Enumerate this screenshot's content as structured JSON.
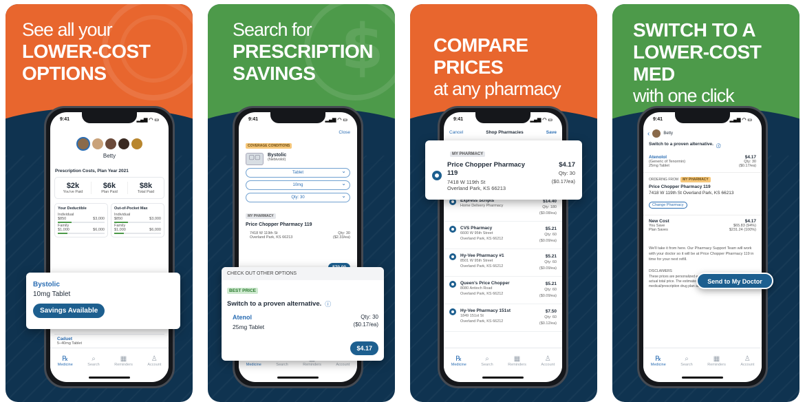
{
  "cards": [
    {
      "headline": {
        "light": "See all your",
        "bold": "LOWER-COST OPTIONS"
      },
      "band_color": "#e8662e",
      "phone": {
        "time": "9:41",
        "user_name": "Betty",
        "section_title": "Prescription Costs, Plan Year 2021",
        "stats": [
          {
            "value": "$2k",
            "label": "You've Paid"
          },
          {
            "value": "$6k",
            "label": "Plan Paid"
          },
          {
            "value": "$8k",
            "label": "Total Paid"
          }
        ],
        "deductible": {
          "title": "Your Deductible",
          "individual": "Individual",
          "family": "Family",
          "v1": "$850",
          "v2": "$3,000",
          "v3": "$1,000",
          "v4": "$6,000"
        },
        "oop": {
          "title": "Out-of-Pocket Max",
          "individual": "Individual",
          "family": "Family",
          "v1": "$850",
          "v2": "$3,000",
          "v3": "$1,000",
          "v4": "$6,000"
        },
        "list_item": {
          "name": "Caduet",
          "detail": "5–40mg Tablet"
        },
        "tabs": [
          "Medicine",
          "Search",
          "Reminders",
          "Account"
        ]
      },
      "popup": {
        "drug": "Bystolic",
        "dose": "10mg Tablet",
        "button": "Savings Available"
      }
    },
    {
      "headline": {
        "light": "Search for",
        "bold": "PRESCRIPTION SAVINGS"
      },
      "band_color": "#4d9a4a",
      "phone": {
        "time": "9:41",
        "close": "Close",
        "badge": "COVERAGE CONDITIONS",
        "drug": "Bystolic",
        "generic": "(Nebivolol)",
        "selects": [
          "Tablet",
          "10mg",
          "Qty: 30"
        ],
        "pharmacy_badge": "MY PHARMACY",
        "pharmacy": "Price Chopper Pharmacy 119",
        "address1": "7418 W 119th St",
        "address2": "Overland Park, KS 66213",
        "qty": "Qty: 30",
        "unit": "($2.33/ea)",
        "price": "$70.00",
        "tabs": [
          "Medicine",
          "Search",
          "Reminders",
          "Account"
        ]
      },
      "popup": {
        "header": "CHECK OUT OTHER OPTIONS",
        "badge": "BEST PRICE",
        "title": "Switch to a proven alternative.",
        "drug": "Atenol",
        "dose": "25mg Tablet",
        "qty": "Qty: 30",
        "unit": "($0.17/ea)",
        "price": "$4.17"
      }
    },
    {
      "headline": {
        "bold": "COMPARE PRICES",
        "light": "at any pharmacy"
      },
      "band_color": "#e8662e",
      "phone": {
        "time": "9:41",
        "cancel": "Cancel",
        "title": "Shop Pharmacies",
        "save": "Save",
        "rows": [
          {
            "name": "Express Scripts",
            "addr1": "Home Delivery Pharmacy",
            "addr2": "",
            "price": "$14.40",
            "qty": "Qty: 180",
            "unit": "($0.08/ea)"
          },
          {
            "name": "CVS Pharmacy",
            "addr1": "6600 W 95th Street",
            "addr2": "Overland Park, KS 66212",
            "price": "$5.21",
            "qty": "Qty: 60",
            "unit": "($0.09/ea)"
          },
          {
            "name": "Hy-Vee Pharmacy #1",
            "addr1": "8501 W 95th Street",
            "addr2": "Overland Park, KS 66212",
            "price": "$5.21",
            "qty": "Qty: 60",
            "unit": "($0.09/ea)"
          },
          {
            "name": "Queen's Price Chopper",
            "addr1": "8080 Antioch Road",
            "addr2": "Overland Park, KS 66212",
            "price": "$5.21",
            "qty": "Qty: 60",
            "unit": "($0.09/ea)"
          },
          {
            "name": "Hy-Vee Pharmacy 151st",
            "addr1": "1849 151st St",
            "addr2": "Overland Park, KS 66212",
            "price": "$7.50",
            "qty": "Qty: 60",
            "unit": "($0.12/ea)"
          }
        ],
        "tabs": [
          "Medicine",
          "Search",
          "Reminders",
          "Account"
        ]
      },
      "popup": {
        "badge": "MY PHARMACY",
        "name": "Price Chopper Pharmacy 119",
        "addr1": "7418 W 119th St",
        "addr2": "Overland Park, KS 66213",
        "price": "$4.17",
        "qty": "Qty: 30",
        "unit": "($0.17/ea)"
      }
    },
    {
      "headline": {
        "bold": "SWITCH TO A LOWER-COST MED",
        "light": "with one click"
      },
      "band_color": "#4d9a4a",
      "phone": {
        "time": "9:41",
        "user_name": "Betty",
        "title": "Switch to a proven alternative.",
        "drug": "Atenolol",
        "generic": "(Generic of Tenormin)",
        "dose": "25mg Tablet",
        "price": "$4.17",
        "qty": "Qty: 30",
        "unit": "($0.17/ea)",
        "ordering_from": "ORDERING FROM",
        "my_pharmacy": "MY PHARMACY",
        "pharmacy": "Price Chopper Pharmacy 119",
        "address": "7418 W 119th St Overland Park, KS 66213",
        "change": "Change Pharmacy",
        "new_cost_label": "New Cost",
        "new_cost": "$4.17",
        "you_save_label": "You Save",
        "you_save": "$65.83 (94%)",
        "plan_saves_label": "Plan Saves",
        "plan_saves": "$231.24 (100%)",
        "note": "We'll take it from here. Our Pharmacy Support Team will work with your doctor so it will be at Price Chopper Pharmacy 119 in time for your next refill.",
        "disclaimer_title": "DISCLAIMERS",
        "disclaimer": "These prices are personalized estimates and may not reflect the actual total price. The estimates are based upon your medical/prescription drug plan as of today. However, the",
        "tabs": [
          "Medicine",
          "Search",
          "Reminders",
          "Account"
        ]
      },
      "popup": {
        "button": "Send to My Doctor"
      }
    }
  ]
}
